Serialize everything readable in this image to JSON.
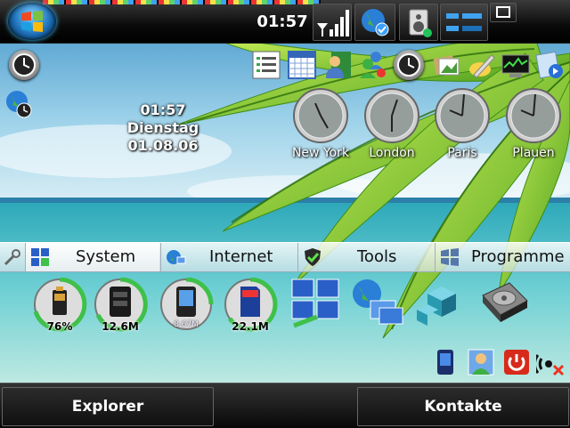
{
  "statusbar": {
    "time": "01:57"
  },
  "date": {
    "time": "01:57",
    "weekday": "Dienstag",
    "date": "01.08.06"
  },
  "world_clocks": [
    {
      "city": "New York"
    },
    {
      "city": "London"
    },
    {
      "city": "Paris"
    },
    {
      "city": "Plauen"
    }
  ],
  "tabs": [
    {
      "label": "System",
      "active": true
    },
    {
      "label": "Internet",
      "active": false
    },
    {
      "label": "Tools",
      "active": false
    },
    {
      "label": "Programme",
      "active": false
    }
  ],
  "gauges": [
    {
      "label": "76%",
      "icon": "battery-icon"
    },
    {
      "label": "12.6M",
      "icon": "memory-icon"
    },
    {
      "label": "8.67M",
      "icon": "device-storage-icon"
    },
    {
      "label": "22.1M",
      "icon": "sd-card-icon"
    }
  ],
  "softkeys": {
    "left": "Explorer",
    "right": "Kontakte"
  },
  "colors": {
    "bar_dark": "#0a0a0a",
    "tab_bg": "#e6eef2",
    "accent_blue": "#1d6fb8",
    "sky": "#6fb6d6"
  }
}
